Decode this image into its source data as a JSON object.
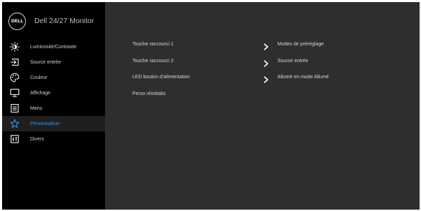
{
  "header": {
    "logo_text": "DELL",
    "title": "Dell 24/27 Monitor"
  },
  "sidebar": {
    "items": [
      {
        "label": "Luminosité/Contraste",
        "icon": "brightness-icon",
        "selected": false
      },
      {
        "label": "Source entrée",
        "icon": "input-source-icon",
        "selected": false
      },
      {
        "label": "Couleur",
        "icon": "color-palette-icon",
        "selected": false
      },
      {
        "label": "Affichage",
        "icon": "display-icon",
        "selected": false
      },
      {
        "label": "Menu",
        "icon": "menu-icon",
        "selected": false
      },
      {
        "label": "Personnaliser",
        "icon": "star-icon",
        "selected": true
      },
      {
        "label": "Divers",
        "icon": "others-icon",
        "selected": false
      }
    ]
  },
  "content": {
    "rows": [
      {
        "label": "Touche raccourci 1",
        "value": "Modes de préréglage",
        "has_arrow": true
      },
      {
        "label": "Touche raccourci 2",
        "value": "Source entrée",
        "has_arrow": true
      },
      {
        "label": "LED bouton d'alimentation",
        "value": "Allumé en mode Allumé",
        "has_arrow": true
      },
      {
        "label": "Perso réinitialis",
        "value": "",
        "has_arrow": false
      }
    ]
  },
  "colors": {
    "panel": "#2e2e2e",
    "sidebar": "#000000",
    "selected_text": "#3e94e1",
    "selected_bg": "#1f1f1f"
  }
}
